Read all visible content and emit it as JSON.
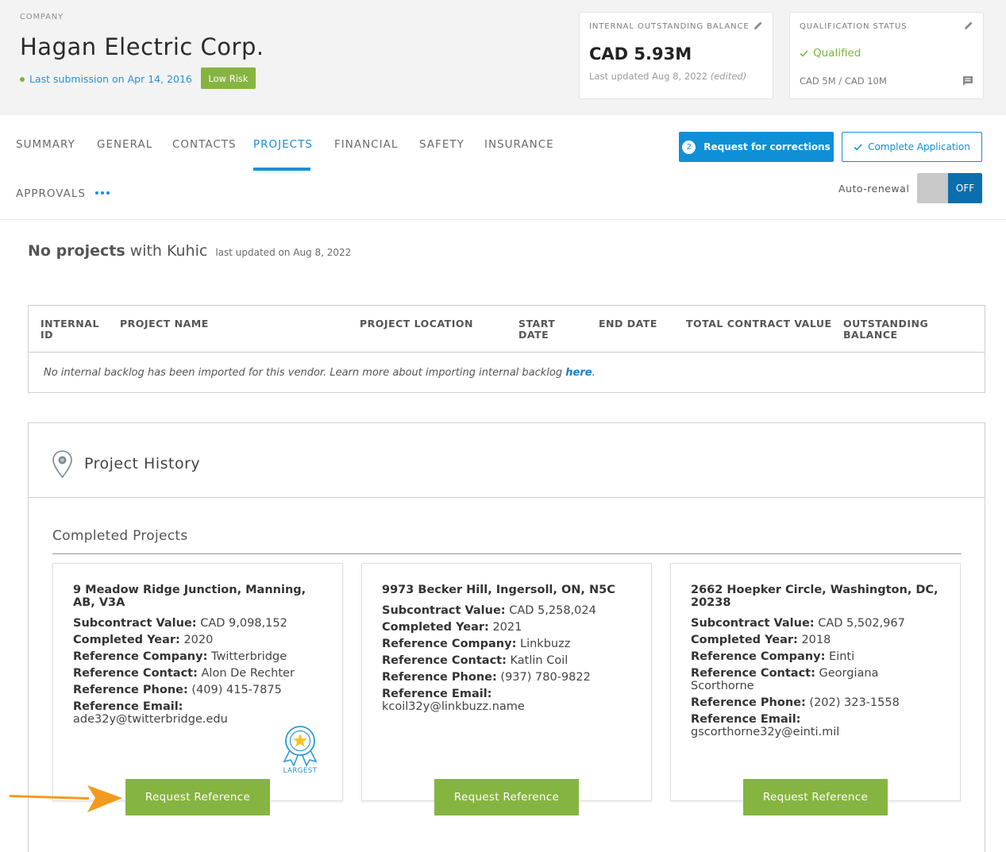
{
  "header": {
    "company_label": "COMPANY",
    "company_name": "Hagan Electric Corp.",
    "submission_text": "Last submission on Apr 14, 2016",
    "risk_badge": "Low Risk",
    "balance_card": {
      "label": "INTERNAL OUTSTANDING BALANCE",
      "value": "CAD 5.93M",
      "updated": "Last updated Aug 8, 2022",
      "edited": "(edited)"
    },
    "qualification_card": {
      "label": "QUALIFICATION STATUS",
      "status": "Qualified",
      "range": "CAD 5M / CAD 10M"
    }
  },
  "tabs": {
    "summary": "SUMMARY",
    "general": "GENERAL",
    "contacts": "CONTACTS",
    "projects": "PROJECTS",
    "financial": "FINANCIAL",
    "safety": "SAFETY",
    "insurance": "INSURANCE",
    "approvals": "APPROVALS",
    "active": "PROJECTS"
  },
  "actions": {
    "corrections_count": "2",
    "corrections_label": "Request for corrections",
    "complete_label": "Complete Application",
    "auto_renewal_label": "Auto-renewal",
    "auto_renewal_state": "OFF"
  },
  "projects_heading": {
    "bold": "No projects",
    "rest": "with Kuhic",
    "updated": "last updated on Aug 8, 2022"
  },
  "backlog_table": {
    "columns": [
      "INTERNAL ID",
      "PROJECT NAME",
      "PROJECT LOCATION",
      "START DATE",
      "END DATE",
      "TOTAL CONTRACT VALUE",
      "OUTSTANDING BALANCE"
    ],
    "empty_message": "No internal backlog has been imported for this vendor. Learn more about importing internal backlog ",
    "empty_link": "here"
  },
  "project_history": {
    "title": "Project History",
    "completed_title": "Completed Projects",
    "field_labels": {
      "subcontract_value": "Subcontract Value:",
      "completed_year": "Completed Year:",
      "reference_company": "Reference Company:",
      "reference_contact": "Reference Contact:",
      "reference_phone": "Reference Phone:",
      "reference_email": "Reference Email:"
    },
    "largest_label": "LARGEST",
    "request_button": "Request Reference",
    "projects": [
      {
        "address": "9 Meadow Ridge Junction, Manning, AB, V3A",
        "subcontract_value": "CAD 9,098,152",
        "completed_year": "2020",
        "reference_company": "Twitterbridge",
        "reference_contact": "Alon De Rechter",
        "reference_phone": "(409) 415-7875",
        "reference_email": "ade32y@twitterbridge.edu"
      },
      {
        "address": "9973 Becker Hill, Ingersoll, ON, N5C",
        "subcontract_value": "CAD 5,258,024",
        "completed_year": "2021",
        "reference_company": "Linkbuzz",
        "reference_contact": "Katlin Coil",
        "reference_phone": "(937) 780-9822",
        "reference_email": "kcoil32y@linkbuzz.name"
      },
      {
        "address": "2662 Hoepker Circle, Washington, DC, 20238",
        "subcontract_value": "CAD 5,502,967",
        "completed_year": "2018",
        "reference_company": "Einti",
        "reference_contact": "Georgiana Scorthorne",
        "reference_phone": "(202) 323-1558",
        "reference_email": "gscorthorne32y@einti.mil"
      }
    ]
  },
  "colors": {
    "primary_blue": "#0f90d6",
    "green": "#86b440",
    "arrow_orange": "#f39a1e"
  }
}
